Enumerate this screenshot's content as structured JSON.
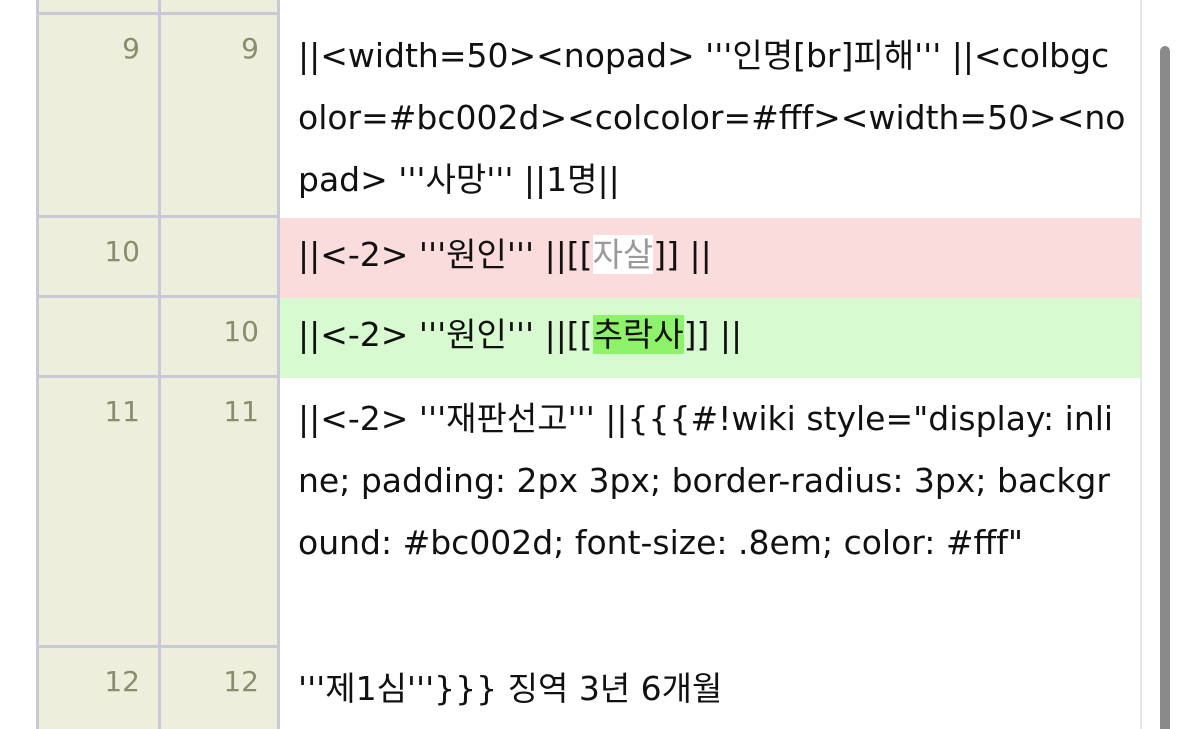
{
  "rows": [
    {
      "old": "",
      "new": "",
      "code": "|| ''' ''' ||[[ ]] ||"
    },
    {
      "old": "9",
      "new": "9",
      "code": "||<width=50><nopad> '''인명[br]피해''' ||<colbgcolor=#bc002d><colcolor=#fff><width=50><nopad> '''사망''' ||1명||"
    },
    {
      "old": "10",
      "new": "",
      "prefix": "||<-2> '''원인''' ||[[",
      "changed": "자살",
      "suffix": "]] ||"
    },
    {
      "old": "",
      "new": "10",
      "prefix": "||<-2> '''원인''' ||[[",
      "changed": "추락사",
      "suffix": "]] ||"
    },
    {
      "old": "11",
      "new": "11",
      "code": "||<-2> '''재판선고''' ||{{{#!wiki style=\"display: inline; padding: 2px 3px; border-radius: 3px; background: #bc002d; font-size: .8em; color: #fff\""
    },
    {
      "old": "12",
      "new": "12",
      "code": "'''제1심'''}}} 징역 3년 6개월"
    }
  ],
  "colors": {
    "gutter": "#eeeedd",
    "deleted_line": "#fadcdc",
    "inserted_line": "#d8fad0",
    "inserted_word": "#8ef36a",
    "border": "#c8c8d6"
  }
}
